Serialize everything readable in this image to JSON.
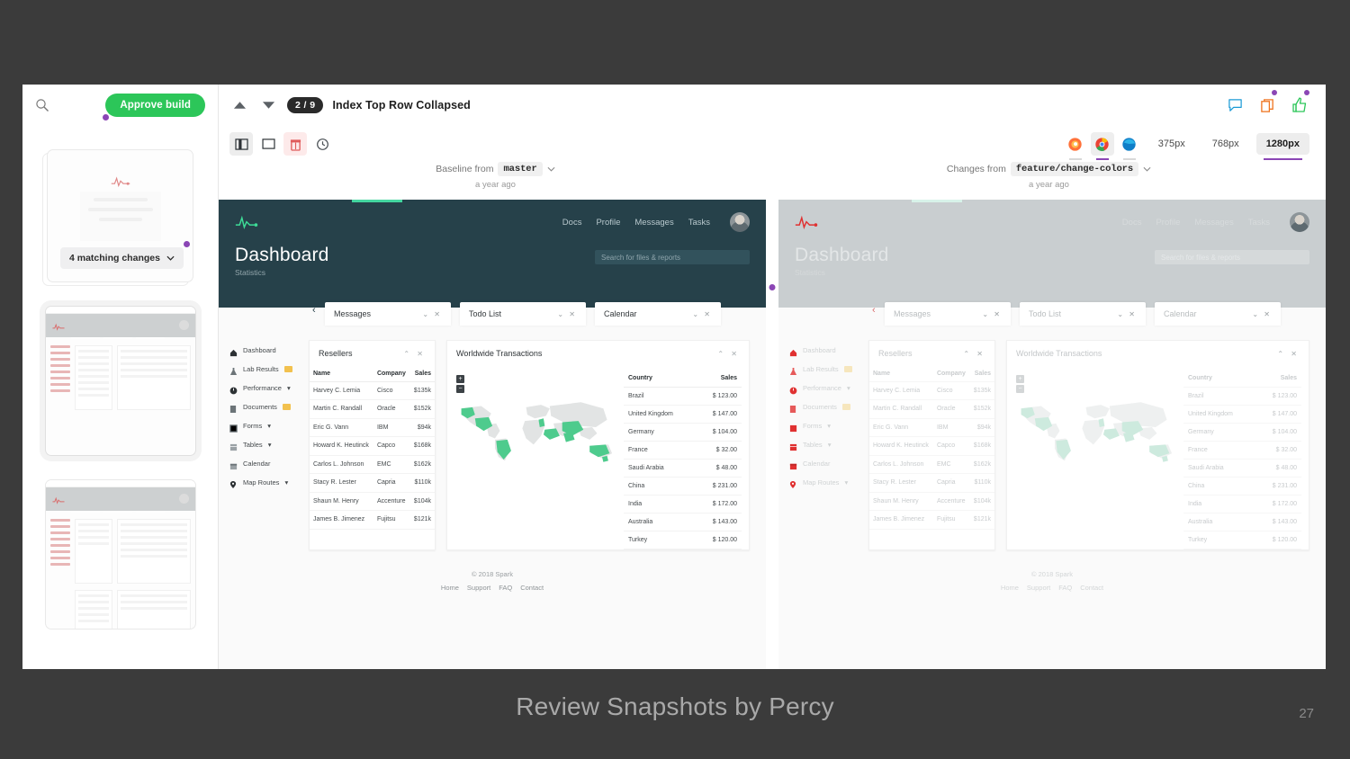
{
  "slide": {
    "caption": "Review Snapshots by Percy",
    "page_number": "27",
    "background": "#3b3b3b"
  },
  "left_sidebar": {
    "search_icon": "search-icon",
    "approve_label": "Approve build",
    "approve_color": "#2cc659",
    "matching_changes_label": "4 matching changes",
    "chevron": "⌄"
  },
  "topbar": {
    "prev_icon": "triangle-up-icon",
    "next_icon": "triangle-down-icon",
    "counter": "2 / 9",
    "title": "Index Top Row Collapsed",
    "comment_icon": "comment-icon",
    "copy_icon": "copy-icon",
    "approve_icon": "thumbs-up-icon",
    "badge_color": "#8b46b5"
  },
  "toolbar": {
    "side_by_side_icon": "side-by-side-view-icon",
    "single_icon": "single-view-icon",
    "diff_icon": "diff-highlight-icon",
    "history_icon": "history-icon",
    "browsers": [
      {
        "name": "firefox-icon",
        "selected": false,
        "underline": true
      },
      {
        "name": "chrome-icon",
        "selected": true,
        "underline": true
      },
      {
        "name": "edge-icon",
        "selected": false,
        "underline": true
      }
    ],
    "widths": [
      {
        "label": "375px",
        "selected": false
      },
      {
        "label": "768px",
        "selected": false
      },
      {
        "label": "1280px",
        "selected": true
      }
    ],
    "accent": "#8b46b5"
  },
  "compare": {
    "baseline": {
      "prefix": "Baseline from",
      "branch": "master",
      "chevron": "⌄",
      "time": "a year ago"
    },
    "changes": {
      "prefix": "Changes from",
      "branch": "feature/change-colors",
      "chevron": "⌄",
      "time": "a year ago"
    }
  },
  "snapshot": {
    "hero": {
      "logo": "heartbeat-logo-icon",
      "title": "Dashboard",
      "subtitle": "Statistics",
      "search_placeholder": "Search for files & reports",
      "nav": [
        {
          "label": "Docs",
          "caret": false
        },
        {
          "label": "Profile",
          "caret": true
        },
        {
          "label": "Messages",
          "caret": true
        },
        {
          "label": "Tasks",
          "caret": true
        }
      ],
      "avatar": "user-avatar",
      "accent_baseline": "#44d6a0",
      "accent_changes": "#d8f3e9"
    },
    "widget_tabs": [
      {
        "label": "Messages"
      },
      {
        "label": "Todo List"
      },
      {
        "label": "Calendar"
      }
    ],
    "collapse_arrow": "‹",
    "sidebar_nav": [
      {
        "label": "Dashboard",
        "icon": "home-icon",
        "badge": null,
        "caret": false
      },
      {
        "label": "Lab Results",
        "icon": "flask-icon",
        "badge": "",
        "caret": false
      },
      {
        "label": "Performance",
        "icon": "speedometer-icon",
        "badge": null,
        "caret": true
      },
      {
        "label": "Documents",
        "icon": "document-icon",
        "badge": "",
        "caret": false
      },
      {
        "label": "Forms",
        "icon": "forms-icon",
        "badge": null,
        "caret": true
      },
      {
        "label": "Tables",
        "icon": "table-icon",
        "badge": null,
        "caret": true
      },
      {
        "label": "Calendar",
        "icon": "calendar-icon",
        "badge": null,
        "caret": false
      },
      {
        "label": "Map Routes",
        "icon": "map-pin-icon",
        "badge": null,
        "caret": true
      }
    ],
    "resellers": {
      "title": "Resellers",
      "columns": [
        "Name",
        "Company",
        "Sales"
      ],
      "rows": [
        {
          "name": "Harvey C. Lemia",
          "company": "Cisco",
          "sales": "$135k"
        },
        {
          "name": "Martin C. Randall",
          "company": "Oracle",
          "sales": "$152k"
        },
        {
          "name": "Eric G. Vann",
          "company": "IBM",
          "sales": "$94k"
        },
        {
          "name": "Howard K. Heutinck",
          "company": "Capco",
          "sales": "$168k"
        },
        {
          "name": "Carlos L. Johnson",
          "company": "EMC",
          "sales": "$162k"
        },
        {
          "name": "Stacy R. Lester",
          "company": "Capria",
          "sales": "$110k"
        },
        {
          "name": "Shaun M. Henry",
          "company": "Accenture",
          "sales": "$104k"
        },
        {
          "name": "James B. Jimenez",
          "company": "Fujitsu",
          "sales": "$121k"
        }
      ]
    },
    "transactions": {
      "title": "Worldwide Transactions",
      "map_zoom_in": "+",
      "map_zoom_out": "−",
      "columns": [
        "Country",
        "Sales"
      ],
      "rows": [
        {
          "country": "Brazil",
          "sales": "$ 123.00"
        },
        {
          "country": "United Kingdom",
          "sales": "$ 147.00"
        },
        {
          "country": "Germany",
          "sales": "$ 104.00"
        },
        {
          "country": "France",
          "sales": "$ 32.00"
        },
        {
          "country": "Saudi Arabia",
          "sales": "$ 48.00"
        },
        {
          "country": "China",
          "sales": "$ 231.00"
        },
        {
          "country": "India",
          "sales": "$ 172.00"
        },
        {
          "country": "Australia",
          "sales": "$ 143.00"
        },
        {
          "country": "Turkey",
          "sales": "$ 120.00"
        }
      ],
      "highlight_color": "#4ecb8d",
      "base_color": "#e2e4e4"
    },
    "footer": {
      "copyright": "© 2018 Spark",
      "links": [
        "Home",
        "Support",
        "FAQ",
        "Contact"
      ]
    }
  }
}
